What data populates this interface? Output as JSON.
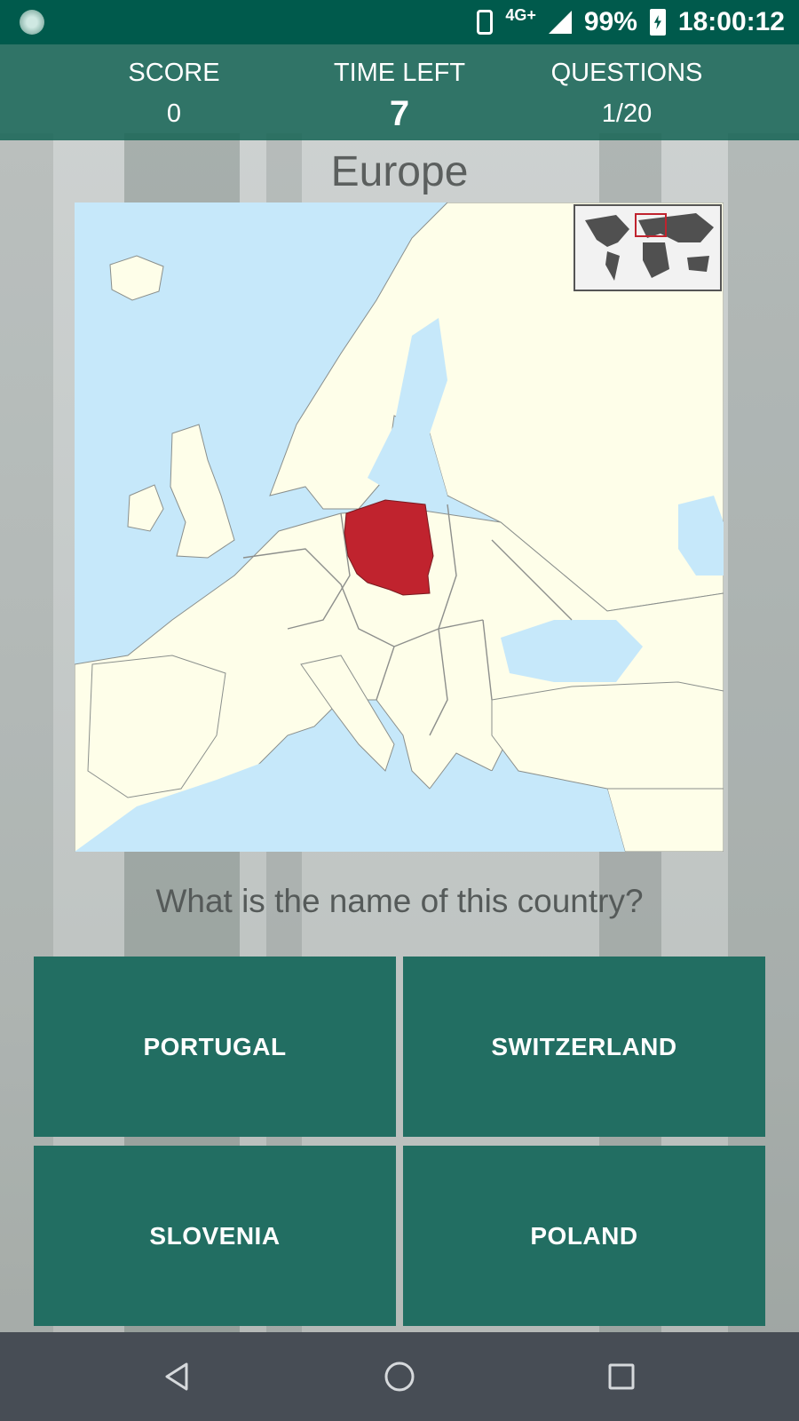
{
  "status_bar": {
    "network": "4G+",
    "battery": "99%",
    "time": "18:00:12"
  },
  "stats": {
    "score_label": "SCORE",
    "score_value": "0",
    "time_label": "TIME LEFT",
    "time_value": "7",
    "questions_label": "QUESTIONS",
    "questions_value": "1/20"
  },
  "quiz": {
    "region": "Europe",
    "question": "What is the name of this country?",
    "highlighted_color": "#c0232e",
    "answers": [
      "PORTUGAL",
      "SWITZERLAND",
      "SLOVENIA",
      "POLAND"
    ]
  },
  "nav": {
    "back_icon": "back-triangle-icon",
    "home_icon": "home-circle-icon",
    "recents_icon": "recents-square-icon"
  }
}
